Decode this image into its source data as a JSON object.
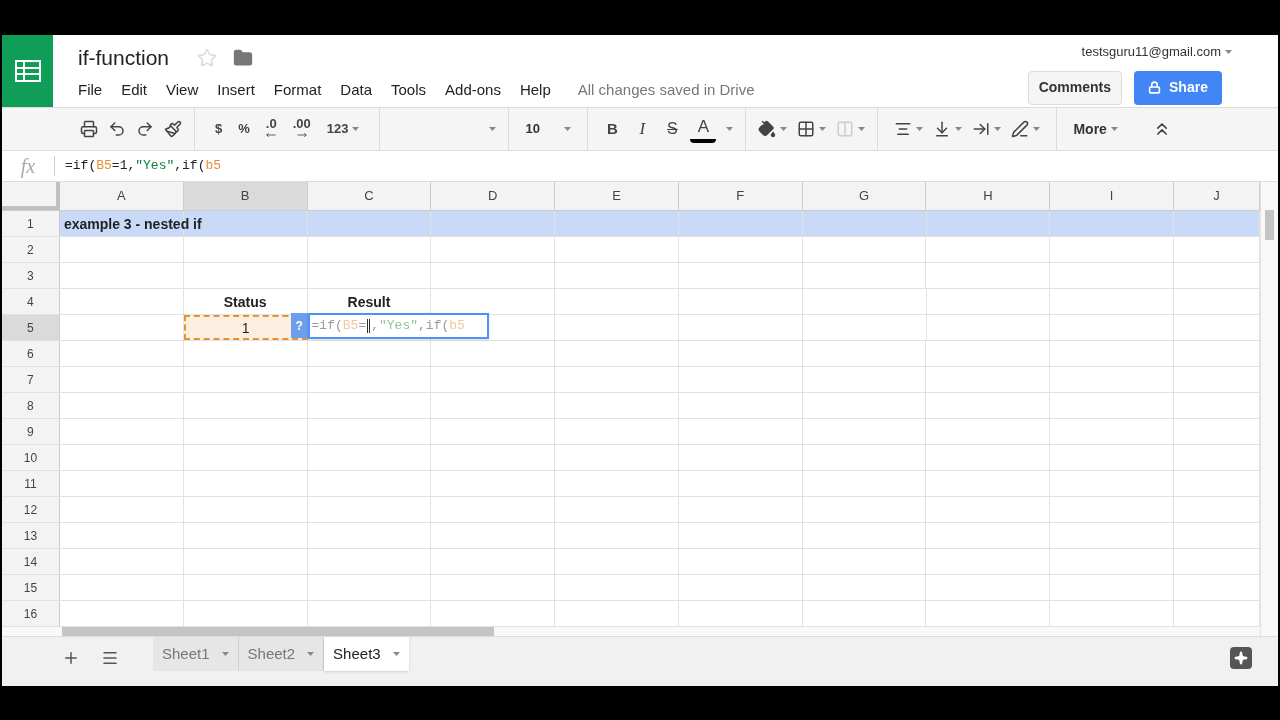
{
  "doc": {
    "title": "if-function"
  },
  "menu": [
    "File",
    "Edit",
    "View",
    "Insert",
    "Format",
    "Data",
    "Tools",
    "Add-ons",
    "Help"
  ],
  "save_status": "All changes saved in Drive",
  "account": "testsguru11@gmail.com",
  "comments_button": "Comments",
  "share_button": "Share",
  "toolbar": {
    "currency": "$",
    "percent": "%",
    "decrease_decimals": ".0",
    "increase_decimals": ".00",
    "number_format": "123",
    "font_size": "10",
    "bold": "B",
    "italic": "I",
    "strikethrough": "S",
    "text_color": "A",
    "more": "More"
  },
  "formula_bar": {
    "label": "fx",
    "segments": [
      {
        "kind": "plain",
        "text": "=if("
      },
      {
        "kind": "ref",
        "text": "B5"
      },
      {
        "kind": "plain",
        "text": "=1,"
      },
      {
        "kind": "string",
        "text": "\"Yes\""
      },
      {
        "kind": "plain",
        "text": ",if("
      },
      {
        "kind": "ref",
        "text": "b5"
      }
    ]
  },
  "columns": [
    {
      "label": "A",
      "selected": false
    },
    {
      "label": "B",
      "selected": true
    },
    {
      "label": "C",
      "selected": false
    },
    {
      "label": "D",
      "selected": false
    },
    {
      "label": "E",
      "selected": false
    },
    {
      "label": "F",
      "selected": false
    },
    {
      "label": "G",
      "selected": false
    },
    {
      "label": "H",
      "selected": false
    },
    {
      "label": "I",
      "selected": false
    },
    {
      "label": "J",
      "selected": false
    }
  ],
  "rows": [
    {
      "number": "1",
      "selected": false,
      "highlighted": true,
      "cells": {
        "A": {
          "text": "example 3 - nested if",
          "bold": true,
          "centered": false
        }
      }
    },
    {
      "number": "2",
      "selected": false,
      "highlighted": false,
      "cells": {}
    },
    {
      "number": "3",
      "selected": false,
      "highlighted": false,
      "cells": {}
    },
    {
      "number": "4",
      "selected": false,
      "highlighted": false,
      "cells": {
        "B": {
          "text": "Status",
          "bold": true,
          "centered": true
        },
        "C": {
          "text": "Result",
          "bold": true,
          "centered": true
        }
      }
    },
    {
      "number": "5",
      "selected": true,
      "highlighted": false,
      "cells": {
        "B": {
          "text": "1",
          "bold": false,
          "centered": true,
          "referenced": true
        },
        "C": {
          "editing": true,
          "help": "?",
          "segments": [
            {
              "kind": "plain",
              "text": "=if("
            },
            {
              "kind": "ref",
              "text": "B5"
            },
            {
              "kind": "plain",
              "text": "="
            },
            {
              "kind": "caret"
            },
            {
              "kind": "plain",
              "text": ","
            },
            {
              "kind": "string",
              "text": "\"Yes\""
            },
            {
              "kind": "plain",
              "text": ",if("
            },
            {
              "kind": "ref",
              "text": "b5"
            }
          ]
        }
      }
    },
    {
      "number": "6",
      "selected": false,
      "highlighted": false,
      "cells": {}
    },
    {
      "number": "7",
      "selected": false,
      "highlighted": false,
      "cells": {}
    },
    {
      "number": "8",
      "selected": false,
      "highlighted": false,
      "cells": {}
    },
    {
      "number": "9",
      "selected": false,
      "highlighted": false,
      "cells": {}
    },
    {
      "number": "10",
      "selected": false,
      "highlighted": false,
      "cells": {}
    },
    {
      "number": "11",
      "selected": false,
      "highlighted": false,
      "cells": {}
    },
    {
      "number": "12",
      "selected": false,
      "highlighted": false,
      "cells": {}
    },
    {
      "number": "13",
      "selected": false,
      "highlighted": false,
      "cells": {}
    },
    {
      "number": "14",
      "selected": false,
      "highlighted": false,
      "cells": {}
    },
    {
      "number": "15",
      "selected": false,
      "highlighted": false,
      "cells": {}
    },
    {
      "number": "16",
      "selected": false,
      "highlighted": false,
      "cells": {}
    }
  ],
  "sheets": [
    {
      "label": "Sheet1",
      "selected": false
    },
    {
      "label": "Sheet2",
      "selected": false
    },
    {
      "label": "Sheet3",
      "selected": true
    }
  ]
}
